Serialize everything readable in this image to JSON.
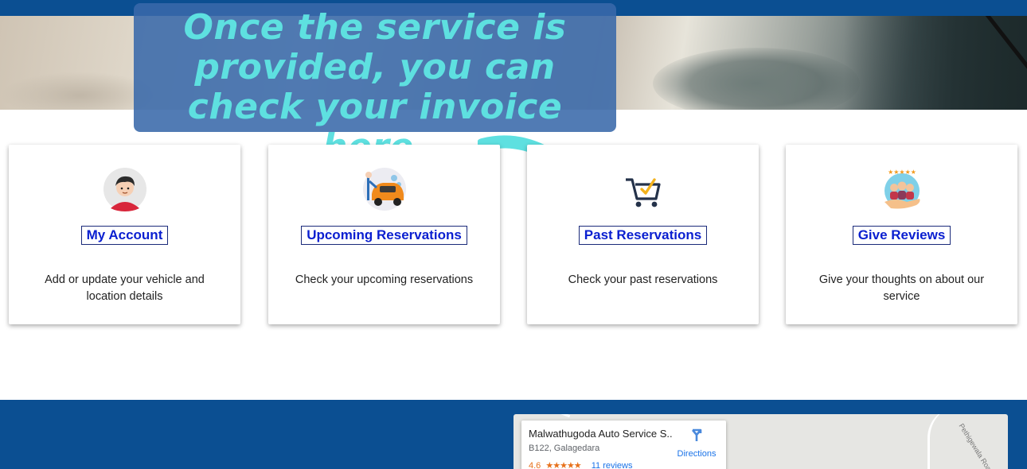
{
  "callout": {
    "text": "Once the service is provided, you can check your invoice here."
  },
  "cards": [
    {
      "title": "My Account",
      "description": "Add or update your vehicle and location details",
      "icon": "user-avatar-icon"
    },
    {
      "title": "Upcoming Reservations",
      "description": "Check your upcoming reservations",
      "icon": "car-wash-icon"
    },
    {
      "title": "Past Reservations",
      "description": "Check your past reservations",
      "icon": "shopping-cart-check-icon"
    },
    {
      "title": "Give Reviews",
      "description": "Give your thoughts on about our service",
      "icon": "reviews-hand-stars-icon"
    }
  ],
  "map": {
    "place_name": "Malwathugoda Auto Service S...",
    "address": "B122, Galagedara",
    "rating": "4.6",
    "stars": "★★★★★",
    "reviews": "11 reviews",
    "directions_label": "Directions",
    "road_label": "Pethigewala Road"
  },
  "colors": {
    "header_blue": "#0b4f92",
    "callout_bg": "#3969aa",
    "callout_text": "#5ee0e0",
    "link_blue": "#0a1fd0"
  }
}
